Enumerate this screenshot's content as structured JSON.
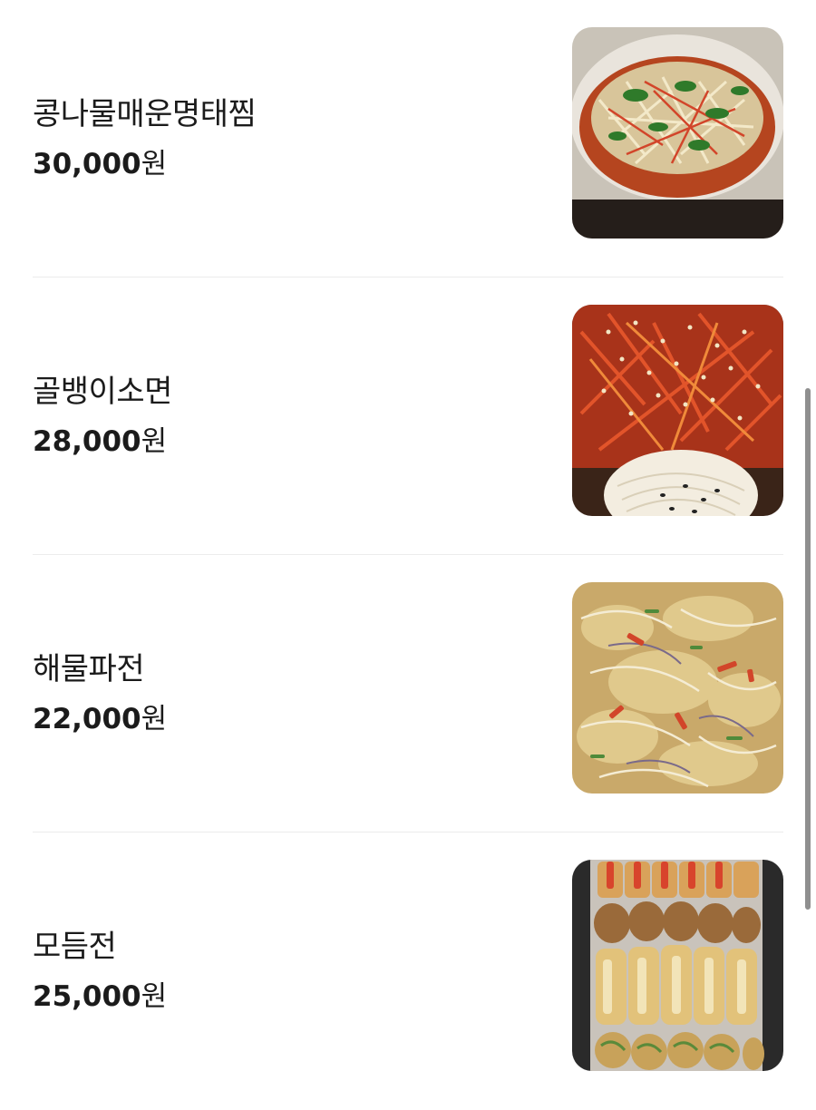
{
  "menu": {
    "items": [
      {
        "name": "콩나물매운명태찜",
        "price": "30,000",
        "unit": "원",
        "image": "spicy-pollock-bean-sprout-photo"
      },
      {
        "name": "골뱅이소면",
        "price": "28,000",
        "unit": "원",
        "image": "whelk-noodle-salad-photo"
      },
      {
        "name": "해물파전",
        "price": "22,000",
        "unit": "원",
        "image": "seafood-pancake-photo"
      },
      {
        "name": "모듬전",
        "price": "25,000",
        "unit": "원",
        "image": "assorted-jeon-photo"
      }
    ]
  },
  "colors": {
    "text": "#1b1b1b",
    "divider": "#ececec",
    "scrollbar": "#8f8f8f"
  }
}
